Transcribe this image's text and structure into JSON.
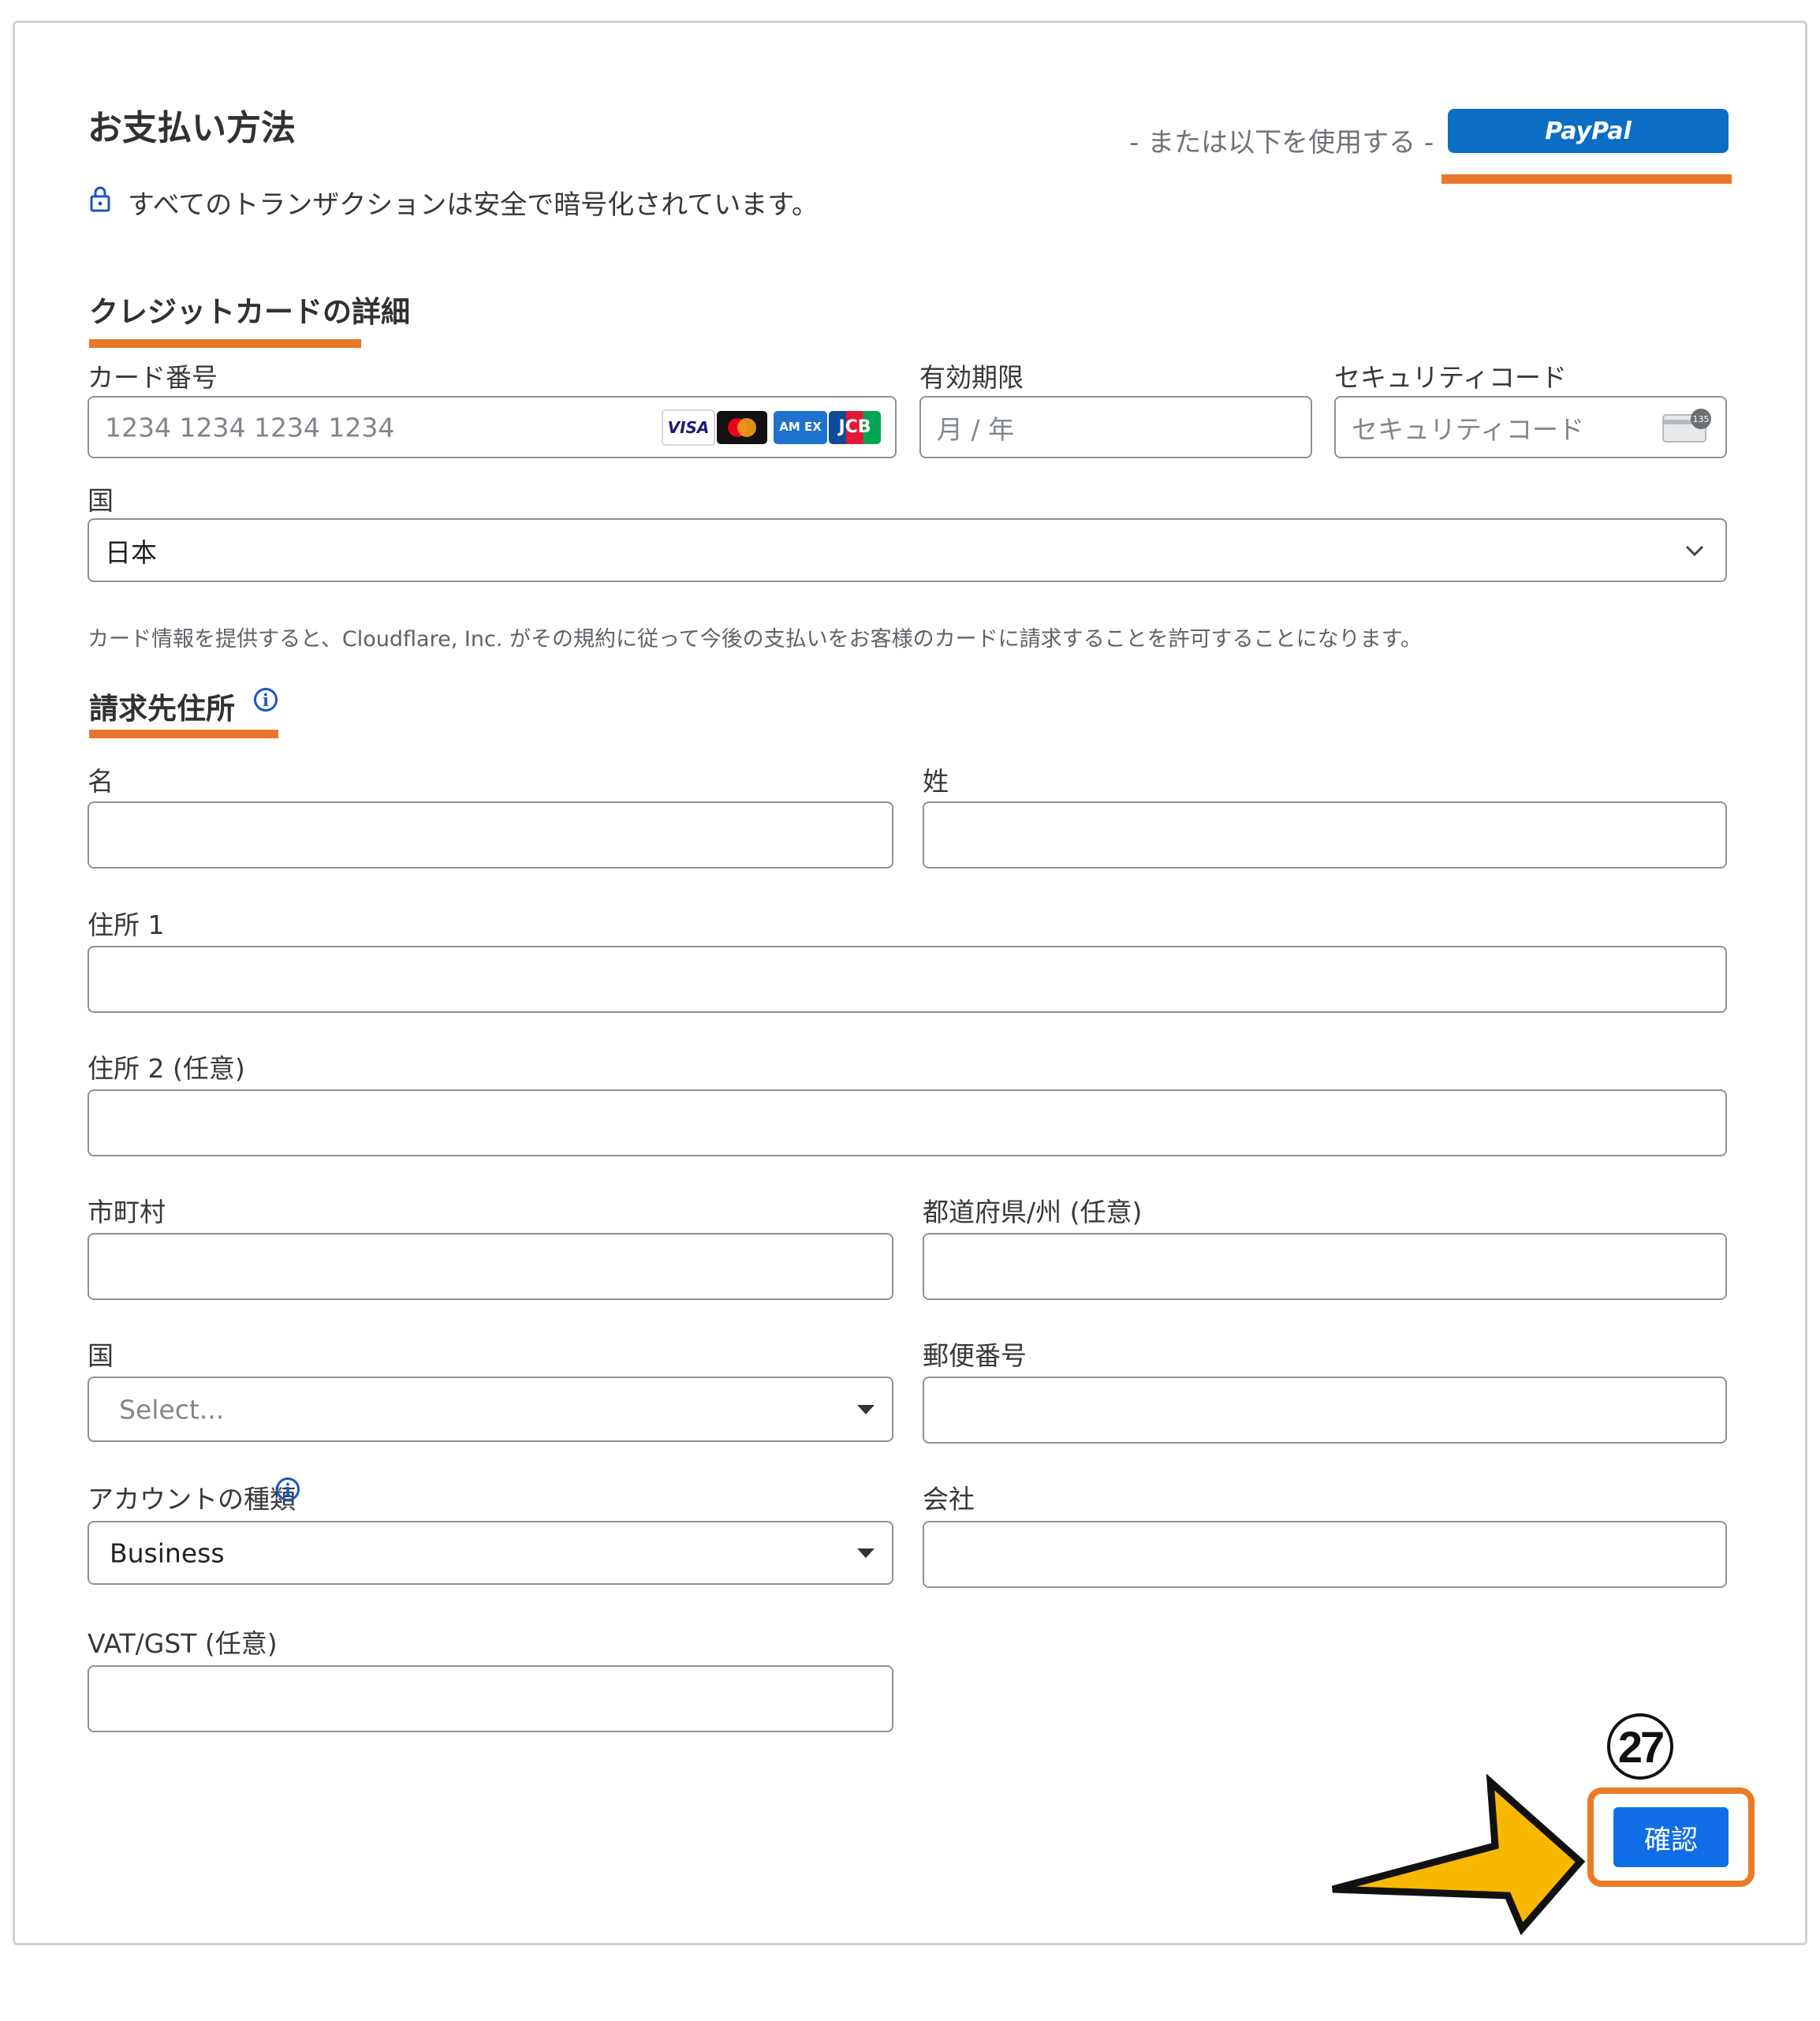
{
  "header": {
    "title": "お支払い方法",
    "secure_text": "すべてのトランザクションは安全で暗号化されています。",
    "or_text": "- または以下を使用する -",
    "paypal_label": "PayPal"
  },
  "card": {
    "section_title": "クレジットカードの詳細",
    "number_label": "カード番号",
    "number_placeholder": "1234 1234 1234 1234",
    "expiry_label": "有効期限",
    "expiry_placeholder": "月 / 年",
    "cvc_label": "セキュリティコード",
    "cvc_placeholder": "セキュリティコード",
    "cvc_badge": "135",
    "brands": {
      "visa": "VISA",
      "amex": "AM EX",
      "jcb": "JCB"
    },
    "country_label": "国",
    "country_value": "日本",
    "notice": "カード情報を提供すると、Cloudflare, Inc. がその規約に従って今後の支払いをお客様のカードに請求することを許可することになります。"
  },
  "billing": {
    "section_title": "請求先住所",
    "first_name_label": "名",
    "last_name_label": "姓",
    "address1_label": "住所 1",
    "address2_label": "住所 2 (任意)",
    "city_label": "市町村",
    "state_label": "都道府県/州 (任意)",
    "country_label": "国",
    "country_placeholder": "Select...",
    "postal_label": "郵便番号",
    "account_type_label": "アカウントの種類",
    "account_type_value": "Business",
    "company_label": "会社",
    "vat_label": "VAT/GST (任意)"
  },
  "footer": {
    "confirm_label": "確認",
    "step_number": "27"
  },
  "colors": {
    "accent_orange": "#e9772b",
    "paypal_blue": "#0a6fc4",
    "confirm_blue": "#0f6ee6",
    "arrow_yellow": "#f9b800"
  }
}
